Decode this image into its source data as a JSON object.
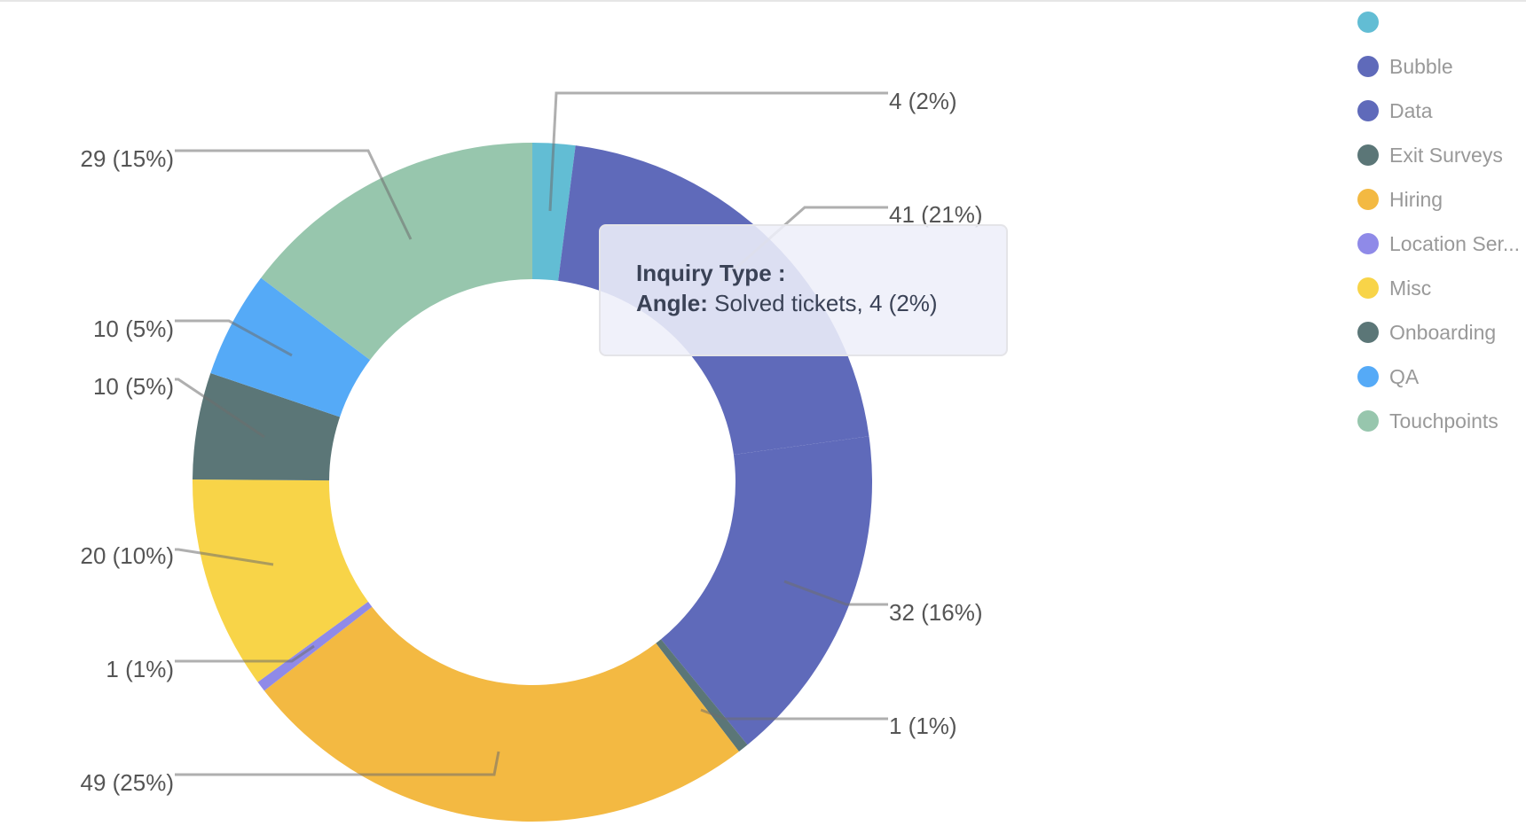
{
  "chart_data": {
    "type": "pie",
    "donut": true,
    "categories": [
      "",
      "Bubble",
      "Data",
      "Exit Surveys",
      "Hiring",
      "Location Ser...",
      "Misc",
      "Onboarding",
      "QA",
      "Touchpoints"
    ],
    "values": [
      4,
      41,
      32,
      1,
      49,
      1,
      20,
      10,
      10,
      29
    ],
    "data_labels": [
      "4 (2%)",
      "41 (21%)",
      "32 (16%)",
      "1 (1%)",
      "49 (25%)",
      "1 (1%)",
      "20 (10%)",
      "10 (5%)",
      "10 (5%)",
      "29 (15%)"
    ],
    "colors": [
      "#62bdd4",
      "#5f6aba",
      "#5f6aba",
      "#5b7677",
      "#f3b942",
      "#8f8ae8",
      "#f8d448",
      "#5b7677",
      "#55aaf7",
      "#97c6ad"
    ],
    "legend_placement": "right",
    "start_angle": "top",
    "direction": "clockwise"
  },
  "tooltip": {
    "title": "Inquiry Type :",
    "series_label": "Angle:",
    "value_text": "Solved tickets, 4 (2%)"
  }
}
